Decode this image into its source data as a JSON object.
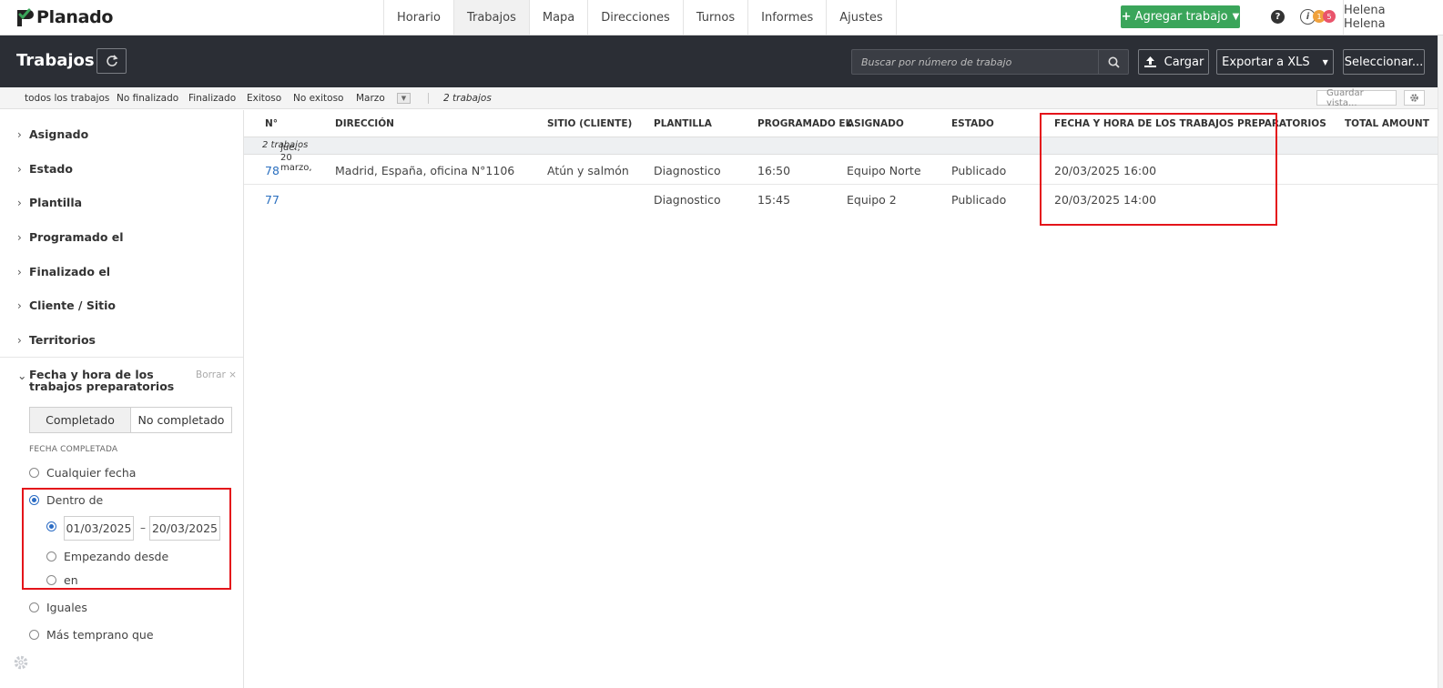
{
  "app": {
    "name": "Planado"
  },
  "nav": {
    "tabs": [
      {
        "label": "Horario"
      },
      {
        "label": "Trabajos"
      },
      {
        "label": "Mapa"
      },
      {
        "label": "Direcciones"
      },
      {
        "label": "Turnos"
      },
      {
        "label": "Informes"
      },
      {
        "label": "Ajustes"
      }
    ],
    "add_job": "Agregar trabajo",
    "help": "?",
    "notif_info": "i",
    "notif_badge_1": "1",
    "notif_badge_2": "5",
    "user": "Helena Helena"
  },
  "header": {
    "title": "Trabajos",
    "search_placeholder": "Buscar por número de trabajo",
    "upload": "Cargar",
    "export": "Exportar a XLS",
    "select": "Seleccionar..."
  },
  "filterbar": {
    "items": [
      "todos los trabajos",
      "No finalizado",
      "Finalizado",
      "Exitoso",
      "No exitoso",
      "Marzo"
    ],
    "count": "2 trabajos",
    "save_view": "Guardar vista..."
  },
  "sidebar": {
    "filters": [
      "Asignado",
      "Estado",
      "Plantilla",
      "Programado el",
      "Finalizado el",
      "Cliente / Sitio",
      "Territorios"
    ],
    "open_filter": {
      "title": "Fecha y hora de los trabajos preparatorios",
      "clear": "Borrar ×",
      "seg_completed": "Completado",
      "seg_not_completed": "No completado",
      "date_label": "FECHA COMPLETADA",
      "opt_any": "Cualquier fecha",
      "opt_within": "Dentro de",
      "date_from": "01/03/2025",
      "date_sep": "–",
      "date_to": "20/03/2025",
      "opt_starting": "Empezando desde",
      "opt_in": "en",
      "opt_equals": "Iguales",
      "opt_earlier": "Más temprano que"
    }
  },
  "table": {
    "headers": {
      "num": "N°",
      "address": "DIRECCIÓN",
      "site": "SITIO (CLIENTE)",
      "template": "PLANTILLA",
      "scheduled": "PROGRAMADO EL",
      "assigned": "ASIGNADO",
      "status": "ESTADO",
      "prep": "FECHA Y HORA DE LOS TRABAJOS PREPARATORIOS",
      "total": "TOTAL AMOUNT"
    },
    "group": {
      "date": "jue., 20 marzo,",
      "count": "2 trabajos"
    },
    "rows": [
      {
        "num": "78",
        "address": "Madrid, España, oficina N°1106",
        "site": "Atún y salmón",
        "template": "Diagnostico",
        "scheduled": "16:50",
        "assigned": "Equipo Norte",
        "status": "Publicado",
        "prep": "20/03/2025 16:00"
      },
      {
        "num": "77",
        "address": "",
        "site": "",
        "template": "Diagnostico",
        "scheduled": "15:45",
        "assigned": "Equipo 2",
        "status": "Publicado",
        "prep": "20/03/2025 14:00"
      }
    ]
  },
  "colors": {
    "accent_green": "#3aa55a",
    "dark_header": "#2b2e35",
    "link_blue": "#2a6fbf",
    "highlight_red": "#e4141a"
  }
}
